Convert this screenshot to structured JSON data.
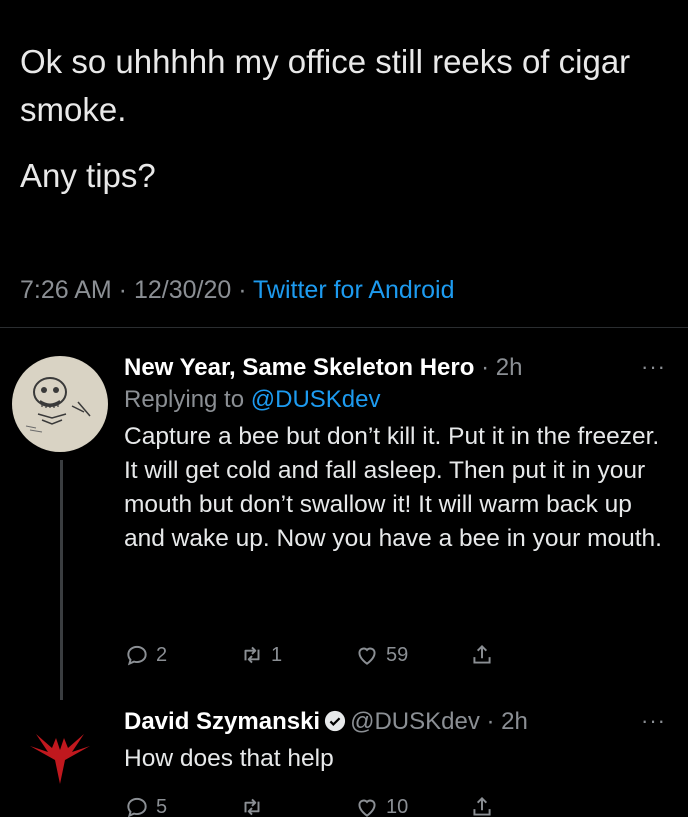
{
  "tweet": {
    "line1": "Ok so uhhhhh my office still reeks of cigar smoke.",
    "line2": "Any tips?",
    "timestamp": "7:26 AM · 12/30/20 · ",
    "source": "Twitter for Android"
  },
  "replies": [
    {
      "display_name": "New Year, Same Skeleton Hero",
      "time": " · 2h",
      "replying_prefix": "Replying to ",
      "replying_to": "@DUSKdev",
      "text": "Capture a bee but don’t kill it. Put it in the freezer. It will get cold and fall asleep. Then put it in your mouth but don’t swallow it! It will warm back up and wake up. Now you have a bee in your mouth.",
      "replies_count": "2",
      "retweets_count": "1",
      "likes_count": "59",
      "more": "···"
    },
    {
      "display_name": "David Szymanski",
      "handle": "@DUSKdev",
      "time": " · 2h",
      "text": "How does that help",
      "replies_count": "5",
      "retweets_count": "",
      "likes_count": "10",
      "more": "···"
    }
  ],
  "colors": {
    "accent": "#1d9bf0",
    "muted": "#8b8f94",
    "background": "#000000",
    "devil": "#c0181e"
  }
}
